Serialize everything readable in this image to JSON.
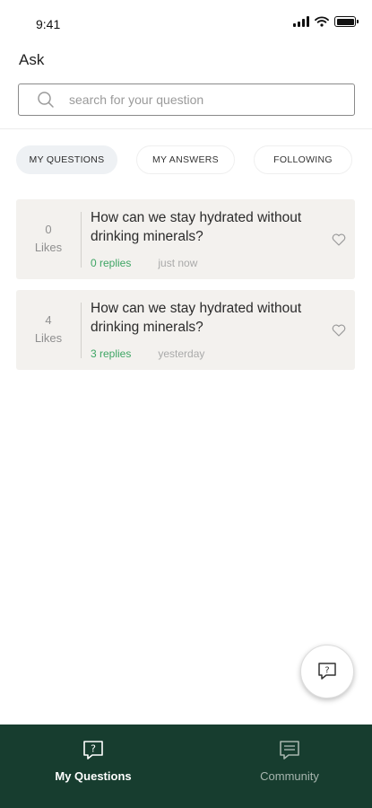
{
  "status_bar": {
    "time": "9:41"
  },
  "header": {
    "title": "Ask"
  },
  "search": {
    "placeholder": "search for your question",
    "value": ""
  },
  "tabs": [
    {
      "label": "MY QUESTIONS",
      "active": true
    },
    {
      "label": "MY ANSWERS",
      "active": false
    },
    {
      "label": "FOLLOWING",
      "active": false
    }
  ],
  "questions": [
    {
      "likes_count": "0",
      "likes_label": "Likes",
      "question": "How can we stay hydrated without drinking minerals?",
      "replies": "0 replies",
      "time": "just now",
      "icon": "heart-outline-icon"
    },
    {
      "likes_count": "4",
      "likes_label": "Likes",
      "question": "How can we stay hydrated without drinking minerals?",
      "replies": "3 replies",
      "time": "yesterday",
      "icon": "heart-outline-icon"
    }
  ],
  "fab": {
    "icon": "ask-question-icon"
  },
  "bottom_nav": [
    {
      "label": "My Questions",
      "icon": "question-bubble-icon",
      "active": true
    },
    {
      "label": "Community",
      "icon": "chat-lines-icon",
      "active": false
    }
  ],
  "colors": {
    "nav_background": "#173d2f",
    "replies_green": "#3ea564",
    "card_background": "#f3f1ee",
    "active_tab_background": "#eef1f4"
  }
}
